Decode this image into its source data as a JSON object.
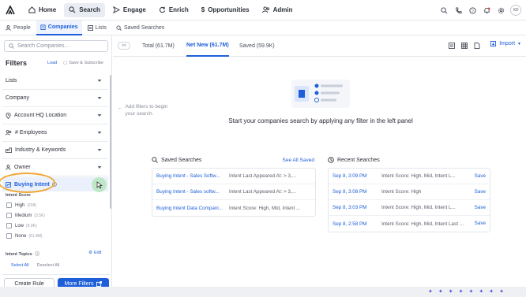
{
  "topnav": {
    "items": [
      {
        "label": "Home",
        "icon": "home-icon"
      },
      {
        "label": "Search",
        "icon": "search-icon",
        "active": true
      },
      {
        "label": "Engage",
        "icon": "send-icon"
      },
      {
        "label": "Enrich",
        "icon": "refresh-icon"
      },
      {
        "label": "Opportunities",
        "icon": "dollar-icon"
      },
      {
        "label": "Admin",
        "icon": "people-icon"
      }
    ],
    "avatar_initials": "XD"
  },
  "subnav": {
    "items": [
      {
        "label": "People",
        "icon": "person-icon"
      },
      {
        "label": "Companies",
        "icon": "building-icon",
        "active": true
      },
      {
        "label": "Lists",
        "icon": "list-icon"
      },
      {
        "label": "Saved Searches",
        "icon": "bookmark-icon"
      }
    ]
  },
  "sidebar": {
    "search_placeholder": "Search Companies...",
    "filters_title": "Filters",
    "load_label": "Load",
    "save_subscribe_label": "Save & Subscribe",
    "filters": [
      {
        "label": "Lists",
        "icon": ""
      },
      {
        "label": "Company",
        "icon": ""
      },
      {
        "label": "Account HQ Location",
        "icon": "pin-icon"
      },
      {
        "label": "# Employees",
        "icon": "people-icon"
      },
      {
        "label": "Industry & Keywords",
        "icon": "industry-icon"
      },
      {
        "label": "Owner",
        "icon": "person-icon"
      }
    ],
    "buying_intent": {
      "label": "Buying Intent",
      "score_label": "Intent Score",
      "options": [
        {
          "label": "High",
          "count": "(238)"
        },
        {
          "label": "Medium",
          "count": "(3.5K)"
        },
        {
          "label": "Low",
          "count": "(9.9K)"
        },
        {
          "label": "None",
          "count": "(61.8M)"
        }
      ],
      "topics_label": "Intent Topics",
      "edit_label": "Edit",
      "select_all": "Select All",
      "deselect_all": "Deselect All"
    },
    "create_rule_label": "Create Rule",
    "more_filters_label": "More Filters"
  },
  "main": {
    "tabs": [
      {
        "label": "Total (61.7M)"
      },
      {
        "label": "Net New (61.7M)",
        "active": true
      },
      {
        "label": "Saved (59.9K)"
      }
    ],
    "import_label": "Import",
    "add_filters_hint": "Add filters to begin your search.",
    "empty_title": "Start your companies search by applying any filter in the left panel",
    "saved_searches": {
      "title": "Saved Searches",
      "see_all": "See All Saved",
      "rows": [
        {
          "name": "Buying Intent - Sales Softw...",
          "detail": "Intent Last Appeared At: > 3,..."
        },
        {
          "name": "Buying Intent - Sales softw...",
          "detail": "Intent Last Appeared At: > 3,..."
        },
        {
          "name": "Buying Intent Data Compani...",
          "detail": "Intent Score: High, Mid, Intent ..."
        }
      ]
    },
    "recent_searches": {
      "title": "Recent Searches",
      "save_label": "Save",
      "rows": [
        {
          "date": "Sep 8, 3:09 PM",
          "detail": "Intent Score: High, Mid, Intent L..."
        },
        {
          "date": "Sep 8, 3:08 PM",
          "detail": "Intent Score: High"
        },
        {
          "date": "Sep 8, 3:03 PM",
          "detail": "Intent Score: High, Mid, Intent L..."
        },
        {
          "date": "Sep 8, 2:58 PM",
          "detail": "Intent Score: High, Mid, Intent Last A..."
        }
      ]
    }
  },
  "colors": {
    "accent": "#1e5fd9",
    "highlight_ring": "#f0a733",
    "cursor_glow": "#bfe8c9"
  }
}
